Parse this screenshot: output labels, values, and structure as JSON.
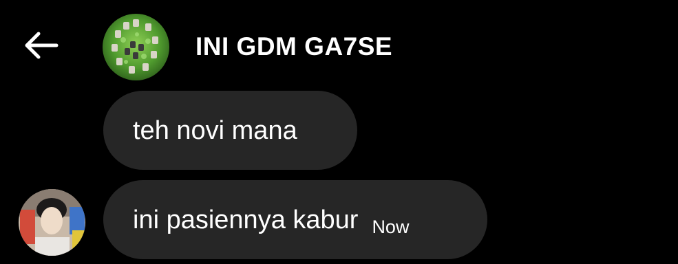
{
  "header": {
    "back_icon": "arrow-left-icon",
    "title": "INI GDM GA7SE"
  },
  "messages": [
    {
      "text": "teh novi mana",
      "time": ""
    },
    {
      "text": "ini pasiennya kabur",
      "time": "Now"
    }
  ],
  "colors": {
    "background": "#000000",
    "bubble": "#262626",
    "text": "#ffffff"
  }
}
